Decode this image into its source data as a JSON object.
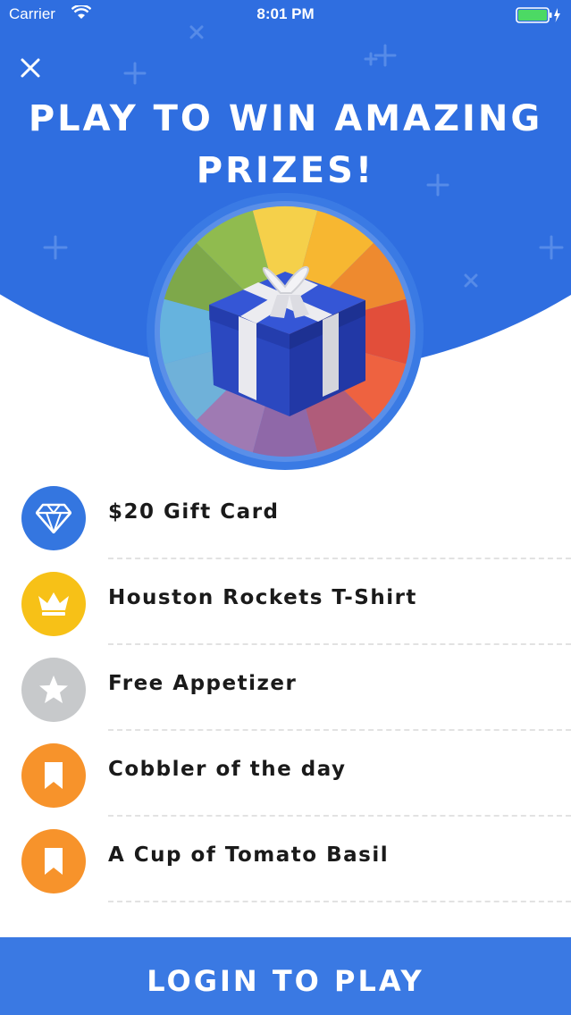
{
  "status_bar": {
    "carrier": "Carrier",
    "time": "8:01 PM",
    "icons": [
      "wifi-icon",
      "battery-icon",
      "charging-icon"
    ]
  },
  "header": {
    "close_icon": "close-icon",
    "title_line1": "PLAY TO WIN AMAZING",
    "title_line2": "PRIZES!",
    "background_color": "#2f6ee0"
  },
  "wheel": {
    "segment_colors": [
      "#f5d04a",
      "#f7b731",
      "#ee8a2f",
      "#e24e3a",
      "#ee6240",
      "#b05c7a",
      "#8f68a8",
      "#9f7ab3",
      "#6fb1d9",
      "#66b3de",
      "#7ea84a",
      "#90bb4f"
    ],
    "icon": "gift-box-icon"
  },
  "prizes": [
    {
      "label": "$20 Gift Card",
      "icon": "diamond-icon",
      "color": "#3476e0"
    },
    {
      "label": "Houston Rockets T-Shirt",
      "icon": "crown-icon",
      "color": "#f7c117"
    },
    {
      "label": "Free Appetizer",
      "icon": "star-icon",
      "color": "#c7c9cb"
    },
    {
      "label": "Cobbler of the day",
      "icon": "bookmark-icon",
      "color": "#f7932b"
    },
    {
      "label": "A Cup of Tomato Basil",
      "icon": "bookmark-icon",
      "color": "#f7932b"
    }
  ],
  "footer": {
    "login_label": "LOGIN TO PLAY",
    "background_color": "#3a79e3"
  }
}
